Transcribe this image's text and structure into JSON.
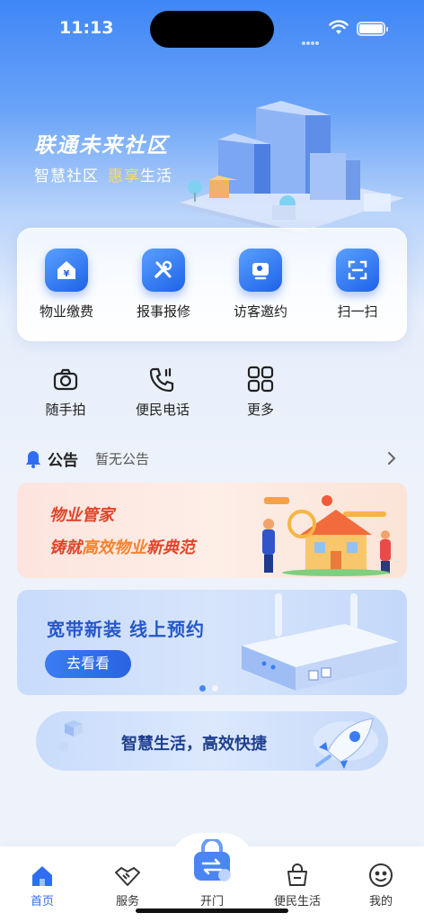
{
  "status_bar": {
    "time": "11:13"
  },
  "hero": {
    "title": "联通未来社区",
    "subtitle_pre": "智慧社区",
    "subtitle_highlight": "惠享",
    "subtitle_post": "生活"
  },
  "services": [
    {
      "label": "物业缴费",
      "icon": "payment-icon"
    },
    {
      "label": "报事报修",
      "icon": "repair-tools-icon"
    },
    {
      "label": "访客邀约",
      "icon": "visitor-icon"
    },
    {
      "label": "扫一扫",
      "icon": "scan-icon"
    }
  ],
  "shortcuts": [
    {
      "label": "随手拍",
      "icon": "camera-icon"
    },
    {
      "label": "便民电话",
      "icon": "phone-icon"
    },
    {
      "label": "更多",
      "icon": "grid-more-icon"
    }
  ],
  "notice": {
    "tag": "公告",
    "text": "暂无公告"
  },
  "banner_property": {
    "line1": "物业管家",
    "line2_pre": "铸就",
    "line2_highlight": "高效物业",
    "line2_post": "新典范"
  },
  "banner_broadband": {
    "title": "宽带新装  线上预约",
    "button": "去看看"
  },
  "banner_smart": {
    "text": "智慧生活，高效快捷"
  },
  "tabbar": [
    {
      "label": "首页",
      "icon": "home-icon",
      "active": true
    },
    {
      "label": "服务",
      "icon": "handshake-icon",
      "active": false
    },
    {
      "label": "开门",
      "icon": "door-open-icon",
      "active": false
    },
    {
      "label": "便民生活",
      "icon": "shopping-bag-icon",
      "active": false
    },
    {
      "label": "我的",
      "icon": "smile-face-icon",
      "active": false
    }
  ],
  "colors": {
    "accent": "#2f6ef0",
    "highlight": "#ffd76a",
    "banner_red": "#e0452a"
  }
}
